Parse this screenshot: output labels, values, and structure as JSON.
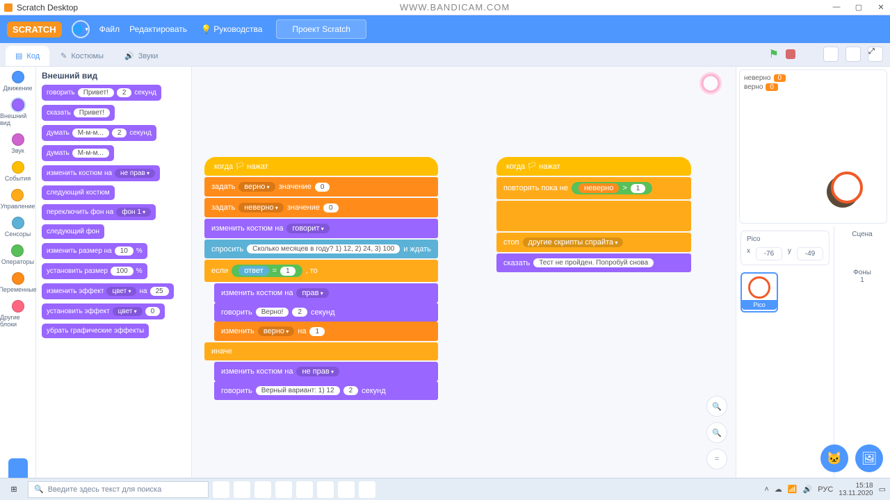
{
  "window": {
    "title": "Scratch Desktop",
    "watermark": "WWW.BANDICAM.COM"
  },
  "menubar": {
    "logo": "SCRATCH",
    "file": "Файл",
    "edit": "Редактировать",
    "tutorials": "Руководства",
    "project_name": "Проект Scratch"
  },
  "tabs": {
    "code": "Код",
    "costumes": "Костюмы",
    "sounds": "Звуки"
  },
  "categories": [
    {
      "label": "Движение",
      "color": "#4c97ff"
    },
    {
      "label": "Внешний вид",
      "color": "#9966ff"
    },
    {
      "label": "Звук",
      "color": "#cf63cf"
    },
    {
      "label": "События",
      "color": "#ffbf00"
    },
    {
      "label": "Управление",
      "color": "#ffab19"
    },
    {
      "label": "Сенсоры",
      "color": "#5cb1d6"
    },
    {
      "label": "Операторы",
      "color": "#59c059"
    },
    {
      "label": "Переменные",
      "color": "#ff8c1a"
    },
    {
      "label": "Другие блоки",
      "color": "#ff6680"
    }
  ],
  "palette": {
    "heading": "Внешний вид",
    "blocks": {
      "say_for": {
        "t1": "говорить",
        "arg": "Привет!",
        "n": "2",
        "t2": "секунд"
      },
      "say": {
        "t1": "сказать",
        "arg": "Привет!"
      },
      "think_for": {
        "t1": "думать",
        "arg": "М-м-м...",
        "n": "2",
        "t2": "секунд"
      },
      "think": {
        "t1": "думать",
        "arg": "М-м-м..."
      },
      "switch_costume": {
        "t1": "изменить костюм на",
        "dd": "не прав"
      },
      "next_costume": {
        "t1": "следующий костюм"
      },
      "switch_bg": {
        "t1": "переключить фон на",
        "dd": "фон 1"
      },
      "next_bg": {
        "t1": "следующий фон"
      },
      "change_size": {
        "t1": "изменить размер на",
        "n": "10",
        "t2": "%"
      },
      "set_size": {
        "t1": "установить размер",
        "n": "100",
        "t2": "%"
      },
      "change_effect": {
        "t1": "изменить эффект",
        "dd": "цвет",
        "t2": "на",
        "n": "25"
      },
      "set_effect": {
        "t1": "установить эффект",
        "dd": "цвет",
        "n": "0"
      },
      "clear_effects": {
        "t1": "убрать графические эффекты"
      }
    }
  },
  "script1": {
    "hat": "когда 🏳 нажат",
    "setv1": {
      "t1": "задать",
      "dd": "верно",
      "t2": "значение",
      "n": "0"
    },
    "setv2": {
      "t1": "задать",
      "dd": "неверно",
      "t2": "значение",
      "n": "0"
    },
    "sw1": {
      "t1": "изменить костюм на",
      "dd": "говорит"
    },
    "ask": {
      "t1": "спросить",
      "q": "Сколько месяцев в году? 1) 12, 2) 24, 3) 100",
      "t2": "и ждать"
    },
    "if": {
      "t1": "если",
      "ans": "ответ",
      "op": "=",
      "n": "1",
      "t2": ", то"
    },
    "sw2": {
      "t1": "изменить костюм на",
      "dd": "прав"
    },
    "say": {
      "t1": "говорить",
      "arg": "Верно!",
      "n": "2",
      "t2": "секунд"
    },
    "chg": {
      "t1": "изменить",
      "dd": "верно",
      "t2": "на",
      "n": "1"
    },
    "else": "иначе",
    "sw3": {
      "t1": "изменить костюм на",
      "dd": "не прав"
    },
    "say2": {
      "t1": "говорить",
      "arg": "Верный вариант: 1) 12",
      "n": "2",
      "t2": "секунд"
    }
  },
  "script2": {
    "hat": "когда 🏳 нажат",
    "until": {
      "t1": "повторять пока не",
      "var": "неверно",
      "op": ">",
      "n": "1"
    },
    "stop": {
      "t1": "стоп",
      "dd": "другие скрипты спрайта"
    },
    "say": {
      "t1": "сказать",
      "arg": "Тест не пройден. Попробуй снова"
    }
  },
  "stage": {
    "mon1_label": "неверно",
    "mon1_val": "0",
    "mon2_label": "верно",
    "mon2_val": "0"
  },
  "sprite": {
    "name": "Pico",
    "x": "-76",
    "y": "-49",
    "thumb_label": "Pico"
  },
  "scene": {
    "label": "Сцена",
    "bg_label": "Фоны",
    "bg_count": "1"
  },
  "taskbar": {
    "search_placeholder": "Введите здесь текст для поиска",
    "lang": "РУС",
    "time": "15:18",
    "date": "13.11.2020"
  }
}
